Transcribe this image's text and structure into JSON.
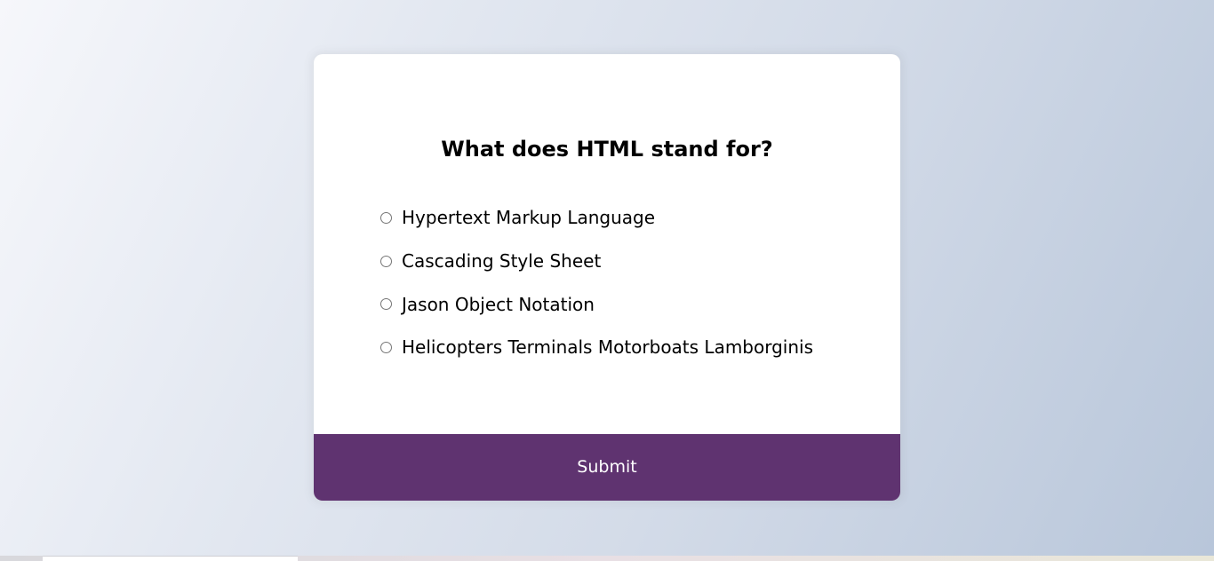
{
  "quiz": {
    "question": "What does HTML stand for?",
    "answers": [
      "Hypertext Markup Language",
      "Cascading Style Sheet",
      "Jason Object Notation",
      "Helicopters Terminals Motorboats Lamborginis"
    ],
    "submit_label": "Submit"
  },
  "colors": {
    "accent": "#5f3370",
    "card": "#ffffff"
  }
}
